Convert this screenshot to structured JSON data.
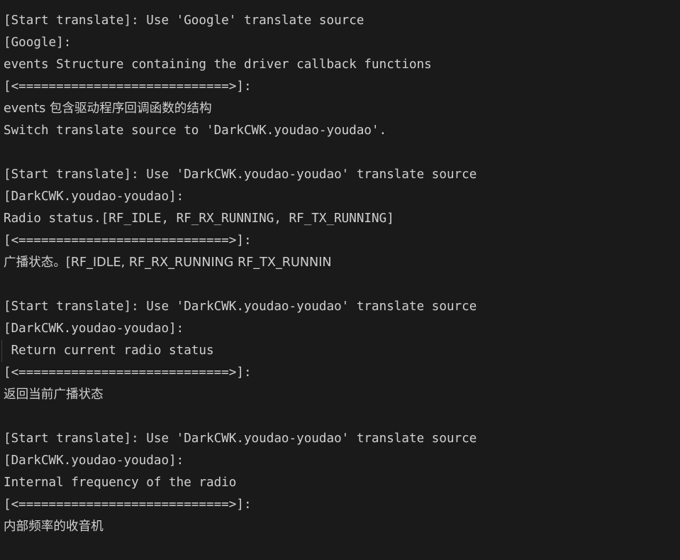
{
  "panel": {
    "name": "translate-output-panel",
    "background_color": "#1a1a1a",
    "text_color": "#cfd0d0",
    "indent_guide_color": "#3f4145"
  },
  "lines": [
    {
      "id": "l1",
      "text": "[Start translate]: Use 'Google' translate source",
      "cjk": false,
      "indent_guide": false
    },
    {
      "id": "l2",
      "text": "[Google]:",
      "cjk": false,
      "indent_guide": false
    },
    {
      "id": "l3",
      "text": "events Structure containing the driver callback functions",
      "cjk": false,
      "indent_guide": false
    },
    {
      "id": "l4",
      "text": "[<============================>]:",
      "cjk": false,
      "indent_guide": false
    },
    {
      "id": "l5",
      "text": "events 包含驱动程序回调函数的结构",
      "cjk": true,
      "indent_guide": false
    },
    {
      "id": "l6",
      "text": "Switch translate source to 'DarkCWK.youdao-youdao'.",
      "cjk": false,
      "indent_guide": false
    },
    {
      "id": "l7",
      "text": "",
      "cjk": false,
      "indent_guide": false
    },
    {
      "id": "l8",
      "text": "[Start translate]: Use 'DarkCWK.youdao-youdao' translate source",
      "cjk": false,
      "indent_guide": false
    },
    {
      "id": "l9",
      "text": "[DarkCWK.youdao-youdao]:",
      "cjk": false,
      "indent_guide": false
    },
    {
      "id": "l10",
      "text": "Radio status.[RF_IDLE, RF_RX_RUNNING, RF_TX_RUNNING]",
      "cjk": false,
      "indent_guide": false
    },
    {
      "id": "l11",
      "text": "[<============================>]:",
      "cjk": false,
      "indent_guide": false
    },
    {
      "id": "l12",
      "text": "广播状态。[RF_IDLE, RF_RX_RUNNING RF_TX_RUNNIN",
      "cjk": true,
      "indent_guide": false
    },
    {
      "id": "l13",
      "text": "",
      "cjk": false,
      "indent_guide": false
    },
    {
      "id": "l14",
      "text": "[Start translate]: Use 'DarkCWK.youdao-youdao' translate source",
      "cjk": false,
      "indent_guide": false
    },
    {
      "id": "l15",
      "text": "[DarkCWK.youdao-youdao]:",
      "cjk": false,
      "indent_guide": false
    },
    {
      "id": "l16",
      "text": " Return current radio status",
      "cjk": false,
      "indent_guide": true
    },
    {
      "id": "l17",
      "text": "[<============================>]:",
      "cjk": false,
      "indent_guide": false
    },
    {
      "id": "l18",
      "text": "返回当前广播状态",
      "cjk": true,
      "indent_guide": false
    },
    {
      "id": "l19",
      "text": "",
      "cjk": false,
      "indent_guide": false
    },
    {
      "id": "l20",
      "text": "[Start translate]: Use 'DarkCWK.youdao-youdao' translate source",
      "cjk": false,
      "indent_guide": false
    },
    {
      "id": "l21",
      "text": "[DarkCWK.youdao-youdao]:",
      "cjk": false,
      "indent_guide": false
    },
    {
      "id": "l22",
      "text": "Internal frequency of the radio",
      "cjk": false,
      "indent_guide": false
    },
    {
      "id": "l23",
      "text": "[<============================>]:",
      "cjk": false,
      "indent_guide": false
    },
    {
      "id": "l24",
      "text": "内部频率的收音机",
      "cjk": true,
      "indent_guide": false
    }
  ]
}
